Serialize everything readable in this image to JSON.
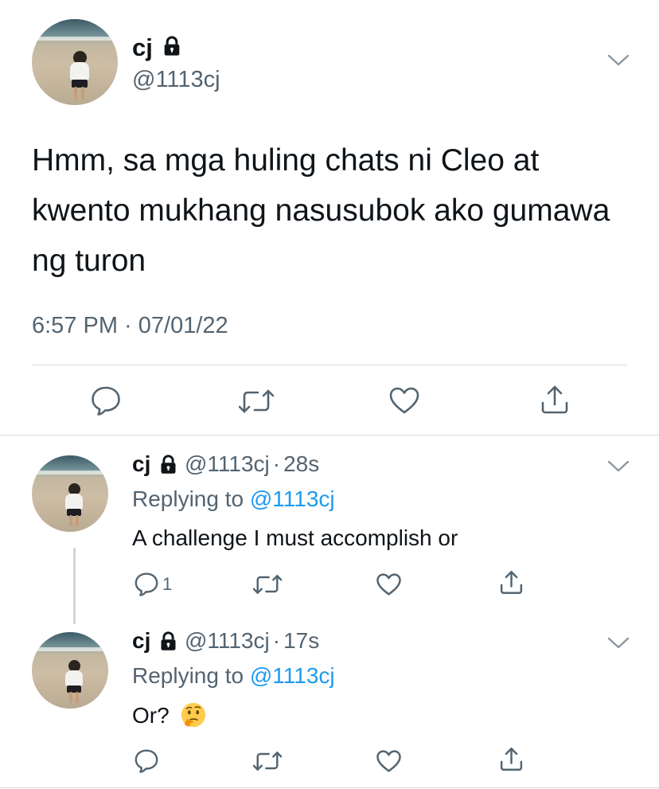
{
  "main_tweet": {
    "name": "cj",
    "handle": "@1113cj",
    "text": "Hmm, sa mga huling chats ni Cleo at kwento mukhang nasusubok ako gumawa ng turon",
    "timestamp": "6:57 PM · 07/01/22",
    "icons": [
      "reply-icon",
      "retweet-icon",
      "like-icon",
      "share-icon"
    ]
  },
  "replies": [
    {
      "name": "cj",
      "handle": "@1113cj",
      "time_sep": "·",
      "time": "28s",
      "replying_prefix": "Replying to",
      "replying_to": "@1113cj",
      "text": "A challenge I must accomplish or",
      "emoji": "",
      "reply_count": "1"
    },
    {
      "name": "cj",
      "handle": "@1113cj",
      "time_sep": "·",
      "time": "17s",
      "replying_prefix": "Replying to",
      "replying_to": "@1113cj",
      "text": "Or?",
      "emoji": "thinking-face-emoji",
      "reply_count": ""
    }
  ],
  "colors": {
    "text": "#0f1419",
    "secondary": "#536471",
    "accent": "#1d9bf0",
    "divider": "#d6dadd"
  }
}
